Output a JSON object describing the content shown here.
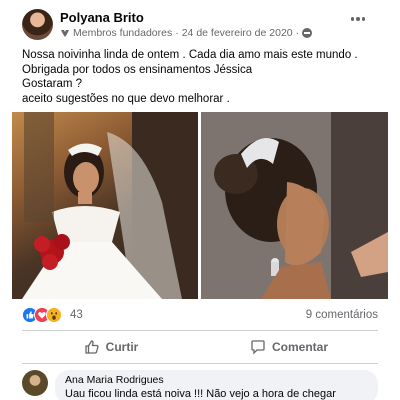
{
  "post": {
    "author": "Polyana Brito",
    "group_role": "Membros fundadores",
    "separator": "·",
    "date": "24 de fevereiro de 2020",
    "text_lines": [
      "Nossa noivinha linda de ontem . Cada dia amo mais este mundo .",
      "Obrigada por todos os ensinamentos Jéssica",
      "Gostaram ?",
      "aceito sugestões no que devo melhorar ."
    ],
    "photos": [
      "bride-full-length-photo",
      "bride-profile-photo"
    ]
  },
  "reactions": {
    "icons": [
      "like-icon",
      "love-icon",
      "wow-icon"
    ],
    "count": "43",
    "comments_label": "9 comentários"
  },
  "actions": {
    "like_label": "Curtir",
    "comment_label": "Comentar"
  },
  "comment": {
    "author": "Ana Maria Rodrigues",
    "text": "Uau ficou linda está noiva !!! Não vejo a hora de chegar"
  },
  "colors": {
    "like_blue": "#1877f2",
    "love_red": "#f33e58",
    "wow_yellow": "#f7b125",
    "secondary_text": "#65676b",
    "comment_bubble": "#f0f2f5"
  }
}
